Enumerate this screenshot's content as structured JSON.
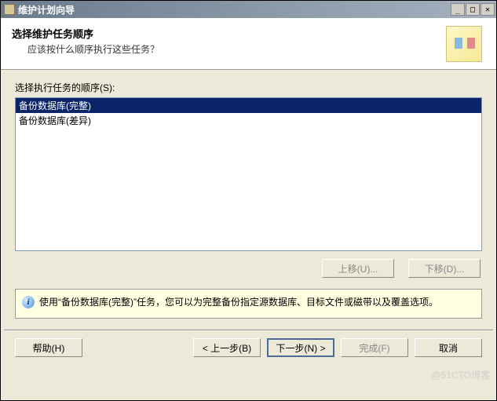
{
  "titlebar": {
    "title": "维护计划向导"
  },
  "header": {
    "title": "选择维护任务顺序",
    "subtitle": "应该按什么顺序执行这些任务？"
  },
  "content": {
    "list_label": "选择执行任务的顺序(S):",
    "tasks": [
      {
        "label": "备份数据库(完整)",
        "selected": true
      },
      {
        "label": "备份数据库(差异)",
        "selected": false
      }
    ],
    "move_up": "上移(U)...",
    "move_down": "下移(D)..."
  },
  "info": {
    "text": "使用“备份数据库(完整)”任务，您可以为完整备份指定源数据库、目标文件或磁带以及覆盖选项。"
  },
  "footer": {
    "help": "帮助(H)",
    "back": "< 上一步(B)",
    "next": "下一步(N) >",
    "finish": "完成(F)",
    "cancel": "取消"
  },
  "watermark": "@51CTO博客"
}
